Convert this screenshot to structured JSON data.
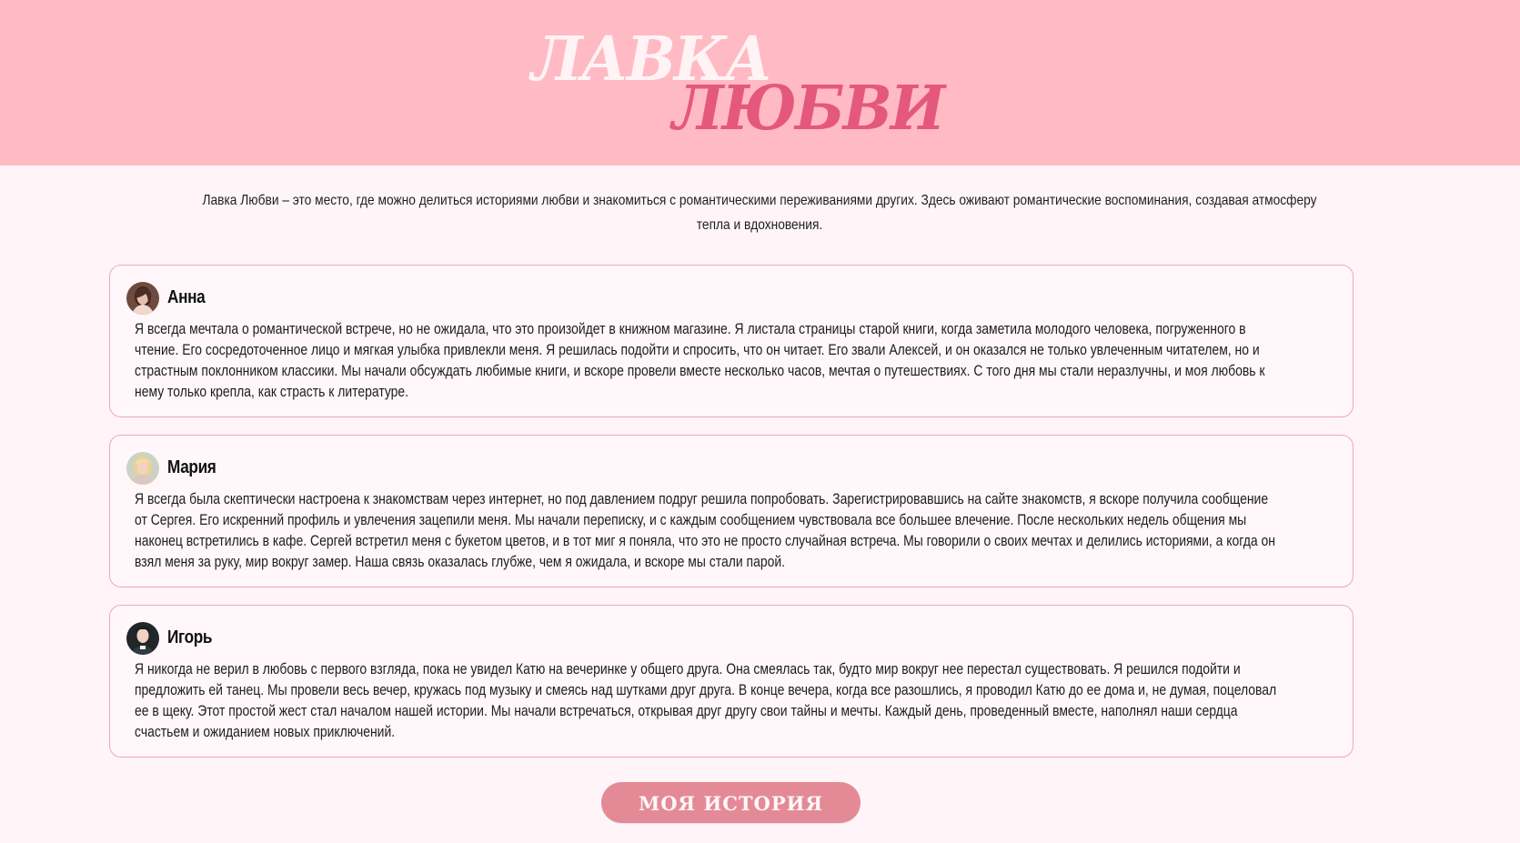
{
  "header": {
    "logo_line_1": "ЛАВКА",
    "logo_line_2": "ЛЮБВИ"
  },
  "intro": {
    "text": "Лавка Любви – это место, где можно делиться историями любви и знакомиться с романтическими переживаниями других. Здесь оживают романтические воспоминания, создавая атмосферу тепла и вдохновения."
  },
  "stories": [
    {
      "name": "Анна",
      "avatar_icon": "avatar-anna-icon",
      "text": "Я всегда мечтала о романтической встрече, но не ожидала, что это произойдет в книжном магазине. Я листала страницы старой книги, когда заметила молодого человека, погруженного в чтение. Его сосредоточенное лицо и мягкая улыбка привлекли меня. Я решилась подойти и спросить, что он читает. Его звали Алексей, и он оказался не только увлеченным читателем, но и страстным поклонником классики. Мы начали обсуждать любимые книги, и вскоре провели вместе несколько часов, мечтая о путешествиях. С того дня мы стали неразлучны, и моя любовь к нему только крепла, как страсть к литературе."
    },
    {
      "name": "Мария",
      "avatar_icon": "avatar-maria-icon",
      "text": "Я всегда была скептически настроена к знакомствам через интернет, но под давлением подруг решила попробовать. Зарегистрировавшись на сайте знакомств, я вскоре получила сообщение от Сергея. Его искренний профиль и увлечения зацепили меня. Мы начали переписку, и с каждым сообщением чувствовала все большее влечение. После нескольких недель общения мы наконец встретились в кафе. Сергей встретил меня с букетом цветов, и в тот миг я поняла, что это не просто случайная встреча. Мы говорили о своих мечтах и делились историями, а когда он взял меня за руку, мир вокруг замер. Наша связь оказалась глубже, чем я ожидала, и вскоре мы стали парой."
    },
    {
      "name": "Игорь",
      "avatar_icon": "avatar-igor-icon",
      "text": "Я никогда не верил в любовь с первого взгляда, пока не увидел Катю на вечеринке у общего друга. Она смеялась так, будто мир вокруг нее перестал существовать. Я решился подойти и предложить ей танец. Мы провели весь вечер, кружась под музыку и смеясь над шутками друг друга. В конце вечера, когда все разошлись, я проводил Катю до ее дома и, не думая, поцеловал ее в щеку. Этот простой жест стал началом нашей истории. Мы начали встречаться, открывая друг другу свои тайны и мечты. Каждый день, проведенный вместе, наполнял наши сердца счастьем и ожиданием новых приключений."
    }
  ],
  "cta": {
    "label": "МОЯ ИСТОРИЯ"
  },
  "colors": {
    "header_bg": "#ffbac3",
    "page_bg": "#fff5f8",
    "logo_light": "#fff3f5",
    "logo_accent": "#e5587d",
    "card_border": "#f0a7b5",
    "button_bg": "#e48a97"
  }
}
